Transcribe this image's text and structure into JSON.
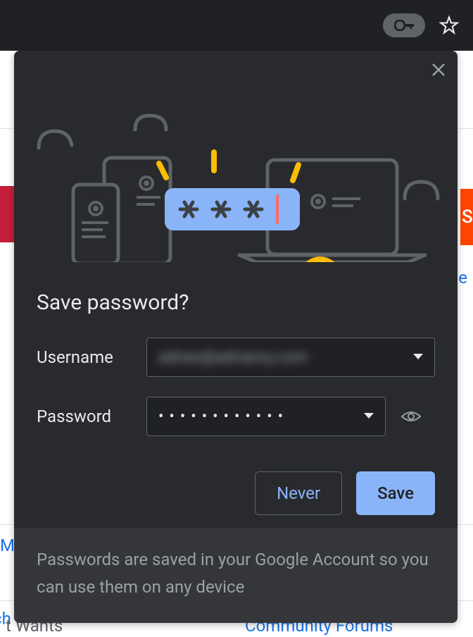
{
  "dialog": {
    "title": "Save password?",
    "username_label": "Username",
    "username_value": "adrian@adriancy.com",
    "password_label": "Password",
    "password_dots": "••••••••••••",
    "never_button": "Never",
    "save_button": "Save",
    "footer_text": "Passwords are saved in your Google Account so you can use them on any device"
  },
  "background": {
    "right_letter": "S",
    "link_tr": "e",
    "link_left_m": "M",
    "link_left_ch": "ch",
    "bottom_left": "t Wants",
    "bottom_right": "Community Forums"
  }
}
